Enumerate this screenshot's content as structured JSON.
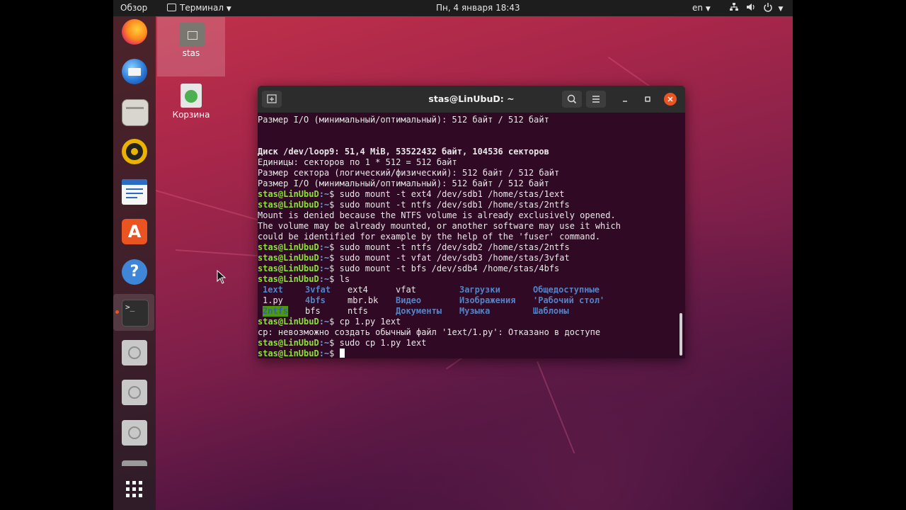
{
  "topbar": {
    "overview": "Обзор",
    "app_menu": "Терминал",
    "clock": "Пн, 4 января  18:43",
    "lang": "en"
  },
  "desktop": {
    "home_label": "stas",
    "trash_label": "Корзина"
  },
  "dock": {
    "items": [
      "Firefox",
      "Thunderbird",
      "Files",
      "Rhythmbox",
      "LibreOffice Writer",
      "Ubuntu Software",
      "Help",
      "Terminal",
      "Disk",
      "Disk",
      "Disk",
      "Show Applications"
    ]
  },
  "terminal": {
    "title": "stas@LinUbuD: ~",
    "prompt_user": "stas@LinUbuD",
    "prompt_path": ":~",
    "prompt_sign": "$ ",
    "lines": [
      {
        "kind": "text",
        "text": "Размер I/O (минимальный/оптимальный): 512 байт / 512 байт"
      },
      {
        "kind": "blank",
        "text": ""
      },
      {
        "kind": "blank",
        "text": ""
      },
      {
        "kind": "bold",
        "text": "Диск /dev/loop9: 51,4 MiB, 53522432 байт, 104536 секторов"
      },
      {
        "kind": "text",
        "text": "Единицы: секторов по 1 * 512 = 512 байт"
      },
      {
        "kind": "text",
        "text": "Размер сектора (логический/физический): 512 байт / 512 байт"
      },
      {
        "kind": "text",
        "text": "Размер I/O (минимальный/оптимальный): 512 байт / 512 байт"
      },
      {
        "kind": "cmd",
        "text": "sudo mount -t ext4 /dev/sdb1 /home/stas/1ext"
      },
      {
        "kind": "cmd",
        "text": "sudo mount -t ntfs /dev/sdb1 /home/stas/2ntfs"
      },
      {
        "kind": "text",
        "text": "Mount is denied because the NTFS volume is already exclusively opened."
      },
      {
        "kind": "text",
        "text": "The volume may be already mounted, or another software may use it which"
      },
      {
        "kind": "text",
        "text": "could be identified for example by the help of the 'fuser' command."
      },
      {
        "kind": "cmd",
        "text": "sudo mount -t ntfs /dev/sdb2 /home/stas/2ntfs"
      },
      {
        "kind": "cmd",
        "text": "sudo mount -t vfat /dev/sdb3 /home/stas/3vfat"
      },
      {
        "kind": "cmd",
        "text": "sudo mount -t bfs /dev/sdb4 /home/stas/4bfs"
      },
      {
        "kind": "cmd",
        "text": "ls"
      }
    ],
    "ls_rows": [
      [
        {
          "t": "1ext",
          "c": "dir"
        },
        {
          "t": "3vfat",
          "c": "dir"
        },
        {
          "t": "ext4",
          "c": "file"
        },
        {
          "t": "vfat",
          "c": "file"
        },
        {
          "t": "Загрузки",
          "c": "dir"
        },
        {
          "t": "Общедоступные",
          "c": "dir"
        }
      ],
      [
        {
          "t": "1.py",
          "c": "file"
        },
        {
          "t": "4bfs",
          "c": "dir"
        },
        {
          "t": "mbr.bk",
          "c": "file"
        },
        {
          "t": "Видео",
          "c": "dir"
        },
        {
          "t": "Изображения",
          "c": "dir"
        },
        {
          "t": "'Рабочий стол'",
          "c": "dir"
        }
      ],
      [
        {
          "t": "2ntfs",
          "c": "sticky"
        },
        {
          "t": "bfs",
          "c": "file"
        },
        {
          "t": "ntfs",
          "c": "file"
        },
        {
          "t": "Документы",
          "c": "dir"
        },
        {
          "t": "Музыка",
          "c": "dir"
        },
        {
          "t": "Шаблоны",
          "c": "dir"
        }
      ]
    ],
    "after": [
      {
        "kind": "cmd",
        "text": "cp 1.py 1ext"
      },
      {
        "kind": "text",
        "text": "cp: невозможно создать обычный файл '1ext/1.py': Отказано в доступе"
      },
      {
        "kind": "cmd",
        "text": "sudo cp 1.py 1ext"
      },
      {
        "kind": "cmd",
        "text": ""
      }
    ]
  }
}
